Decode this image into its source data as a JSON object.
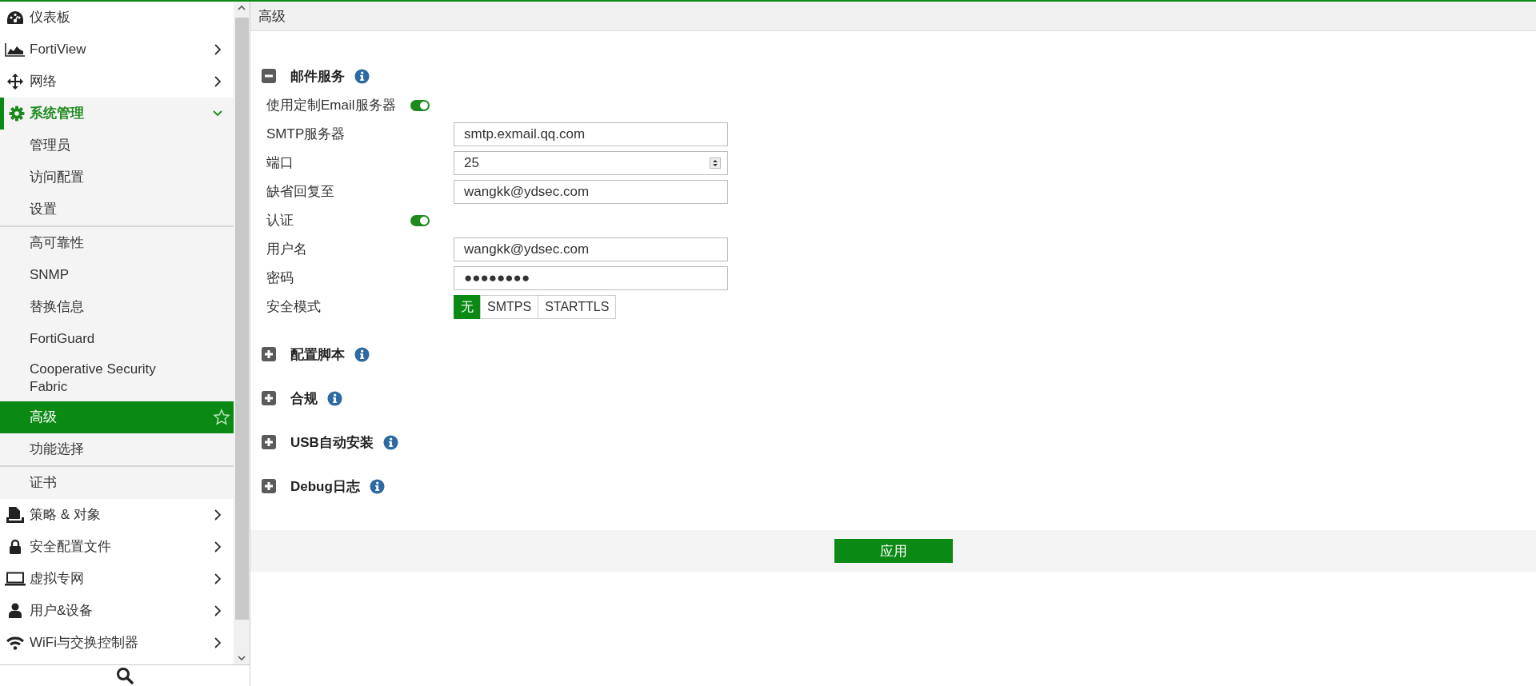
{
  "sidebar": {
    "items": [
      {
        "label": "仪表板",
        "kind": "link"
      },
      {
        "label": "FortiView",
        "kind": "menu",
        "expanded": false
      },
      {
        "label": "网络",
        "kind": "menu",
        "expanded": false
      },
      {
        "label": "系统管理",
        "kind": "menu",
        "expanded": true,
        "child_groups": [
          {
            "items": [
              {
                "label": "管理员",
                "selected": false
              },
              {
                "label": "访问配置",
                "selected": false
              },
              {
                "label": "设置",
                "selected": false
              }
            ]
          },
          {
            "items": [
              {
                "label": "高可靠性",
                "selected": false
              },
              {
                "label": "SNMP",
                "selected": false
              },
              {
                "label": "替换信息",
                "selected": false
              },
              {
                "label": "FortiGuard",
                "selected": false
              },
              {
                "label": "Cooperative Security Fabric",
                "selected": false
              },
              {
                "label": "高级",
                "selected": true
              },
              {
                "label": "功能选择",
                "selected": false
              }
            ]
          },
          {
            "items": [
              {
                "label": "证书",
                "selected": false
              }
            ]
          }
        ]
      },
      {
        "label": "策略 & 对象",
        "kind": "menu",
        "expanded": false
      },
      {
        "label": "安全配置文件",
        "kind": "menu",
        "expanded": false
      },
      {
        "label": "虚拟专网",
        "kind": "menu",
        "expanded": false
      },
      {
        "label": "用户&设备",
        "kind": "menu",
        "expanded": false
      },
      {
        "label": "WiFi与交换控制器",
        "kind": "menu",
        "expanded": false
      }
    ]
  },
  "page": {
    "title": "高级",
    "sections": [
      {
        "title": "邮件服务",
        "expanded": true,
        "fields": [
          {
            "label": "使用定制Email服务器",
            "kind": "toggle",
            "on": true
          },
          {
            "label": "SMTP服务器",
            "kind": "text",
            "value": "smtp.exmail.qq.com"
          },
          {
            "label": "端口",
            "kind": "number",
            "value": "25"
          },
          {
            "label": "缺省回复至",
            "kind": "text",
            "value": "wangkk@ydsec.com"
          },
          {
            "label": "认证",
            "kind": "toggle",
            "on": true
          },
          {
            "label": "用户名",
            "kind": "text",
            "value": "wangkk@ydsec.com"
          },
          {
            "label": "密码",
            "kind": "password",
            "value": "●●●●●●●●"
          },
          {
            "label": "安全模式",
            "kind": "segmented",
            "options": [
              {
                "label": "无",
                "selected": true
              },
              {
                "label": "SMTPS",
                "selected": false
              },
              {
                "label": "STARTTLS",
                "selected": false
              }
            ]
          }
        ]
      },
      {
        "title": "配置脚本",
        "expanded": false
      },
      {
        "title": "合规",
        "expanded": false
      },
      {
        "title": "USB自动安装",
        "expanded": false
      },
      {
        "title": "Debug日志",
        "expanded": false
      }
    ],
    "apply_button": "应用"
  }
}
